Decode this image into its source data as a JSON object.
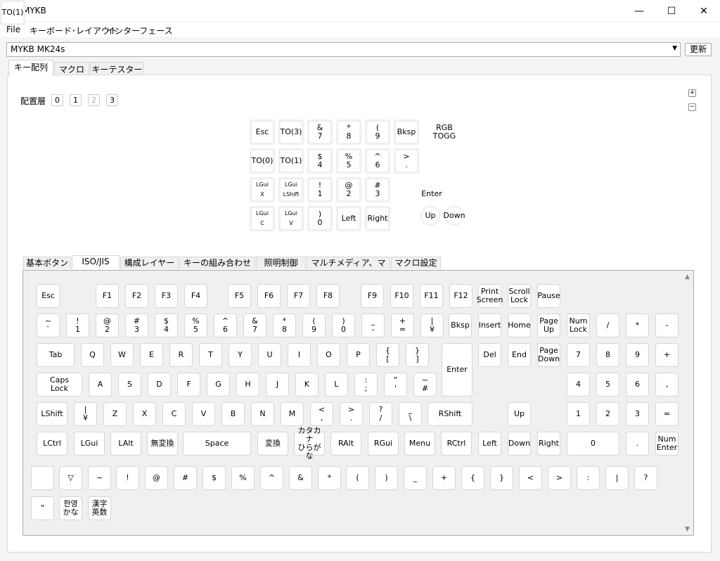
{
  "window": {
    "title": "MYKB",
    "minimize": "—",
    "maximize": "☐",
    "close": "✕"
  },
  "menu": {
    "file": "File",
    "layout": "キーボード･レイアウト",
    "interface": "インターフェース"
  },
  "device": {
    "selected": "MYKB MK24s",
    "refresh": "更新"
  },
  "tabs": [
    "キー配列",
    "マクロ",
    "キーテスター"
  ],
  "layers": {
    "label": "配置層",
    "items": [
      "0",
      "1",
      "2",
      "3"
    ]
  },
  "layout_keys": [
    [
      "Esc",
      "TO(3)",
      "&\n7",
      "*\n8",
      "(\n9",
      "Bksp",
      "RGB\nTOGG"
    ],
    [
      "TO(0)",
      "TO(1)",
      "$\n4",
      "%\n5",
      "^\n6",
      ">\n.",
      "TO(1)"
    ],
    [
      "LGui\nX",
      "LGui\nLShift",
      "!\n1",
      "@\n2",
      "#\n3",
      "Enter"
    ],
    [
      "LGui\nC",
      "LGui\nV",
      ")\n0",
      "Left",
      "Right",
      "Up",
      "Down"
    ]
  ],
  "sub_tabs": [
    "基本ボタン",
    "ISO/JIS",
    "構成レイヤー",
    "キーの組み合わせ",
    "照明制御",
    "マルチメディア、マウス",
    "マクロ設定"
  ],
  "keys": {
    "row0": [
      "Esc",
      "F1",
      "F2",
      "F3",
      "F4",
      "F5",
      "F6",
      "F7",
      "F8",
      "F9",
      "F10",
      "F11",
      "F12",
      "Print\nScreen",
      "Scroll\nLock",
      "Pause"
    ],
    "row1": [
      "~\n`",
      "!\n1",
      "@\n2",
      "#\n3",
      "$\n4",
      "%\n5",
      "^\n6",
      "&\n7",
      "*\n8",
      "(\n9",
      ")\n0",
      "_\n-",
      "+\n=",
      "|\n¥",
      "Bksp",
      "Insert",
      "Home",
      "Page\nUp",
      "Num\nLock",
      "/",
      "*",
      "-"
    ],
    "row2": [
      "Tab",
      "Q",
      "W",
      "E",
      "R",
      "T",
      "Y",
      "U",
      "I",
      "O",
      "P",
      "{\n[",
      "}\n]",
      "Enter",
      "Del",
      "End",
      "Page\nDown",
      "7",
      "8",
      "9",
      "+"
    ],
    "row3": [
      "Caps\nLock",
      "A",
      "S",
      "D",
      "F",
      "G",
      "H",
      "J",
      "K",
      "L",
      ":\n;",
      "\"\n'",
      "~\n#",
      "4",
      "5",
      "6",
      ","
    ],
    "row4": [
      "LShift",
      "|\n¥",
      "Z",
      "X",
      "C",
      "V",
      "B",
      "N",
      "M",
      "<\n,",
      ">\n.",
      "?\n/",
      "_\n\\",
      "RShift",
      "Up",
      "1",
      "2",
      "3",
      "="
    ],
    "row5": [
      "LCtrl",
      "LGui",
      "LAlt",
      "無変換",
      "Space",
      "変換",
      "カタカナ\nひらがな",
      "RAlt",
      "RGui",
      "Menu",
      "RCtrl",
      "Left",
      "Down",
      "Right",
      "0",
      ".",
      "Num\nEnter"
    ],
    "row6": [
      "",
      "▽",
      "~",
      "!",
      "@",
      "#",
      "$",
      "%",
      "^",
      "&",
      "*",
      "(",
      ")",
      "_",
      "+",
      "{",
      "}",
      "<",
      ">",
      ":",
      "|",
      "?"
    ],
    "row7": [
      "\"",
      "한영\nかな",
      "漢字\n英数"
    ]
  },
  "plus": "+",
  "minus": "−"
}
